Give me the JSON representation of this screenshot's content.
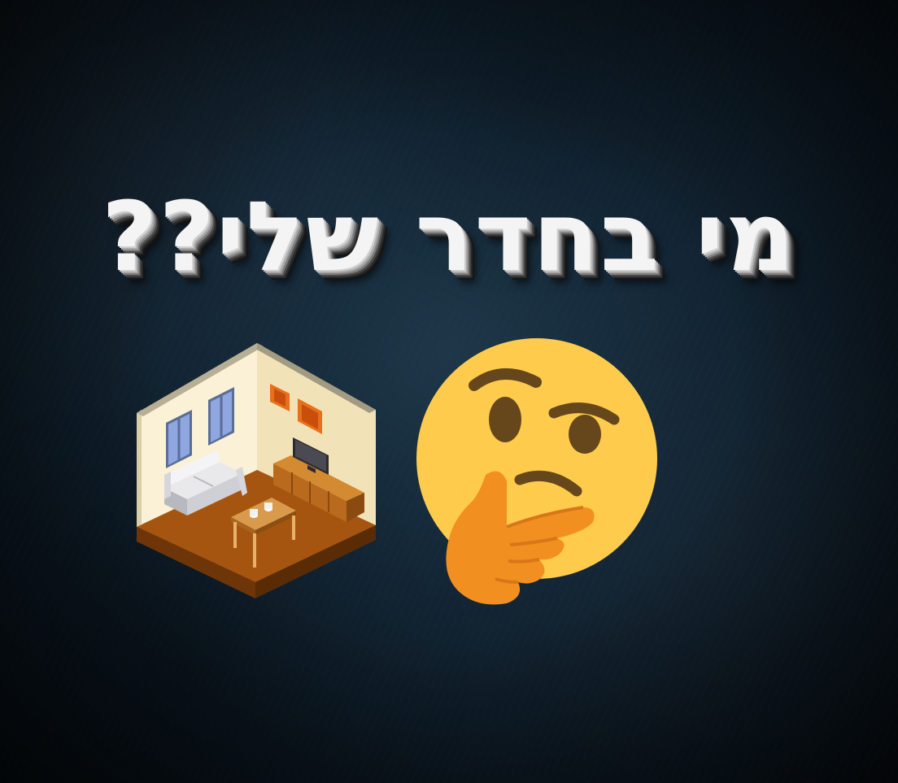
{
  "title": {
    "text": "מי בחדר שלי??"
  },
  "illustrations": {
    "room": "isometric-living-room-icon",
    "thinking": "thinking-face-emoji-icon"
  },
  "colors": {
    "background": "#10202c",
    "title_fill": "#f4f4f4",
    "emoji_face": "#ffcb4c",
    "emoji_hand": "#f19020",
    "room_floor": "#a0520e",
    "room_wall": "#f6e9c4",
    "room_frame_accent": "#e8701a"
  }
}
